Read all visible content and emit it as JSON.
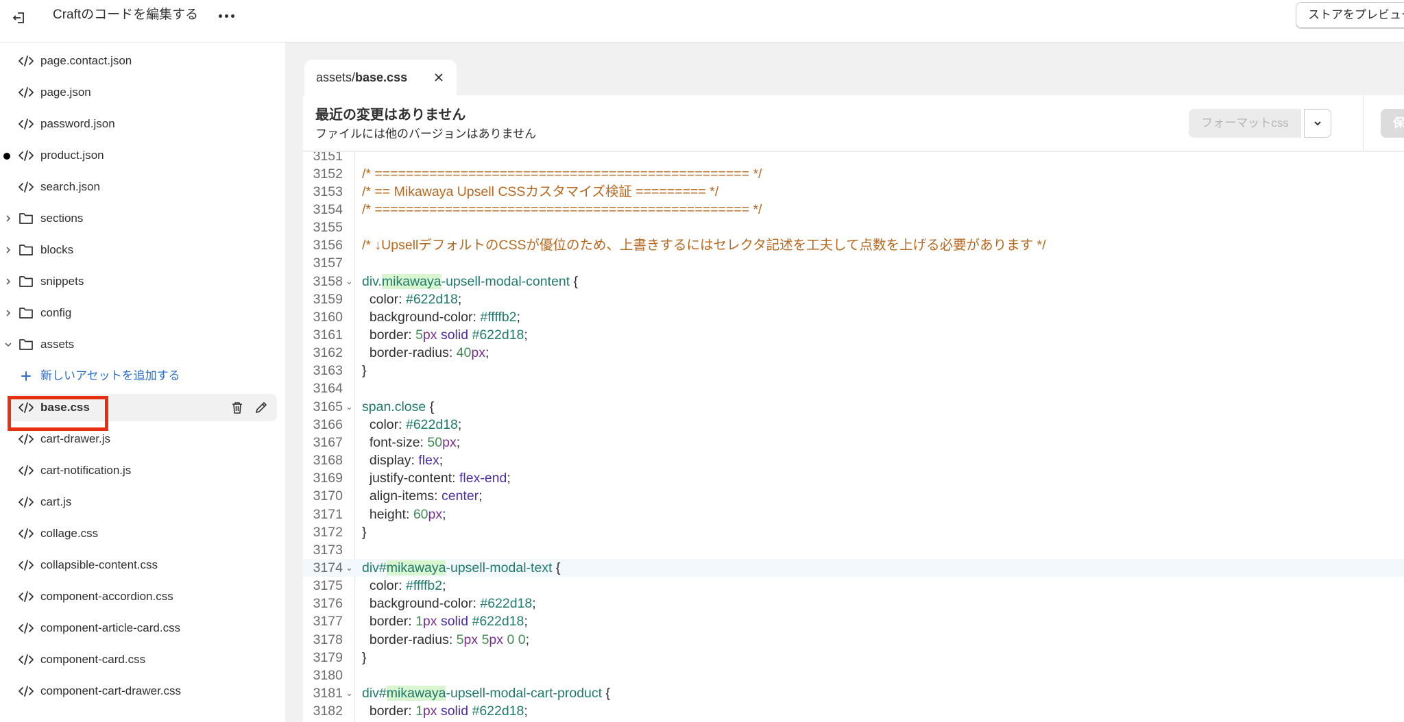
{
  "topbar": {
    "title": "Craftのコードを編集する",
    "preview_button": "ストアをプレビュー"
  },
  "sidebar": {
    "items": [
      {
        "type": "file",
        "label": "page.contact.json"
      },
      {
        "type": "file",
        "label": "page.json"
      },
      {
        "type": "file",
        "label": "password.json"
      },
      {
        "type": "file",
        "label": "product.json",
        "modified": true
      },
      {
        "type": "file",
        "label": "search.json"
      },
      {
        "type": "folder",
        "label": "sections",
        "expanded": false
      },
      {
        "type": "folder",
        "label": "blocks",
        "expanded": false
      },
      {
        "type": "folder",
        "label": "snippets",
        "expanded": false
      },
      {
        "type": "folder",
        "label": "config",
        "expanded": false
      },
      {
        "type": "folder",
        "label": "assets",
        "expanded": true
      },
      {
        "type": "add",
        "label": "新しいアセットを追加する"
      },
      {
        "type": "file",
        "label": "base.css",
        "selected": true
      },
      {
        "type": "file",
        "label": "cart-drawer.js"
      },
      {
        "type": "file",
        "label": "cart-notification.js"
      },
      {
        "type": "file",
        "label": "cart.js"
      },
      {
        "type": "file",
        "label": "collage.css"
      },
      {
        "type": "file",
        "label": "collapsible-content.css"
      },
      {
        "type": "file",
        "label": "component-accordion.css"
      },
      {
        "type": "file",
        "label": "component-article-card.css"
      },
      {
        "type": "file",
        "label": "component-card.css"
      },
      {
        "type": "file",
        "label": "component-cart-drawer.css"
      }
    ]
  },
  "editor": {
    "tab": {
      "dir": "assets/",
      "file": "base.css"
    },
    "info_title": "最近の変更はありません",
    "info_subtitle": "ファイルには他のバージョンはありません",
    "format_button": "フォーマットcss",
    "save_button": "保存",
    "first_line": 3151,
    "active_line": 3174,
    "lines": [
      "",
      "/* ================================================ */",
      "/* == Mikawaya Upsell CSSカスタマイズ検証 ========= */",
      "/* ================================================ */",
      "",
      "/* ↓UpsellデフォルトのCSSが優位のため、上書きするにはセレクタ記述を工夫して点数を上げる必要があります */",
      "",
      "div.mikawaya-upsell-modal-content {",
      "  color: #622d18;",
      "  background-color: #ffffb2;",
      "  border: 5px solid #622d18;",
      "  border-radius: 40px;",
      "}",
      "",
      "span.close {",
      "  color: #622d18;",
      "  font-size: 50px;",
      "  display: flex;",
      "  justify-content: flex-end;",
      "  align-items: center;",
      "  height: 60px;",
      "}",
      "",
      "div#mikawaya-upsell-modal-text {",
      "  color: #ffffb2;",
      "  background-color: #622d18;",
      "  border: 1px solid #622d18;",
      "  border-radius: 5px 5px 0 0;",
      "}",
      "",
      "div#mikawaya-upsell-modal-cart-product {",
      "  border: 1px solid #622d18;"
    ],
    "line_numbers": [
      "3151",
      "3152",
      "3153",
      "3154",
      "3155",
      "3156",
      "3157",
      "3158",
      "3159",
      "3160",
      "3161",
      "3162",
      "3163",
      "3164",
      "3165",
      "3166",
      "3167",
      "3168",
      "3169",
      "3170",
      "3171",
      "3172",
      "3173",
      "3174",
      "3175",
      "3176",
      "3177",
      "3178",
      "3179",
      "3180",
      "3181",
      "3182"
    ],
    "foldable_lines": [
      3158,
      3165,
      3174,
      3181
    ]
  },
  "colors": {
    "accent_link": "#2c6ecb",
    "selection_outline": "#e53012",
    "comment": "#b8681f",
    "selector": "#1f7a6c"
  }
}
